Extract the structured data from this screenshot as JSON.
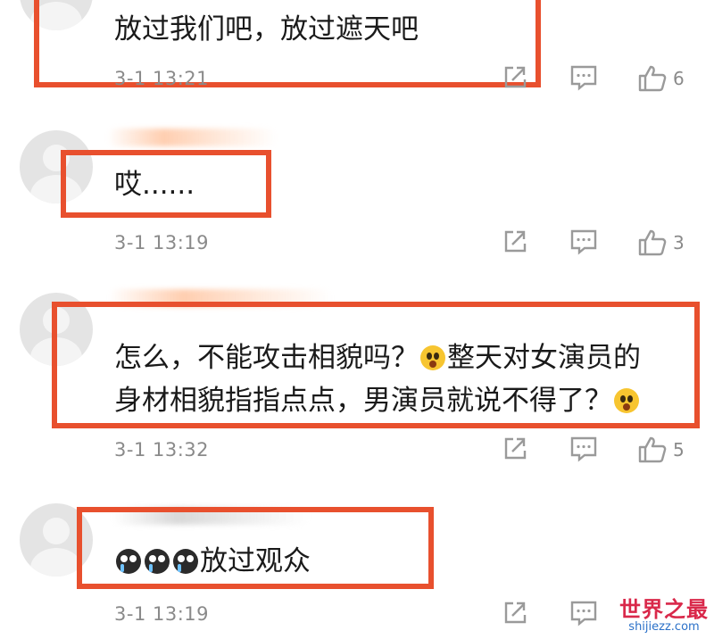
{
  "comments": [
    {
      "text_parts": [
        "放过我们吧，放过遮天吧"
      ],
      "time": "3-1 13:21",
      "likes": "6"
    },
    {
      "text_parts": [
        "哎......"
      ],
      "time": "3-1 13:19",
      "likes": "3"
    },
    {
      "line1": [
        "怎么，不能攻击相貌吗？",
        "整天对女演员的"
      ],
      "line2": [
        "身材相貌指指点点，男演员就说不得了？"
      ],
      "emoji_names": [
        "shocked-face-emoji",
        "shocked-face-emoji"
      ],
      "time": "3-1 13:32",
      "likes": "5"
    },
    {
      "text_parts": [
        "放过观众"
      ],
      "emoji_names": [
        "crying-face-emoji",
        "crying-face-emoji",
        "crying-face-emoji"
      ],
      "time": "3-1 13:19",
      "likes": ""
    }
  ],
  "watermark": {
    "title": "世界之最",
    "url": "shijiezz.com"
  },
  "colors": {
    "highlight": "#e8502e",
    "meta_text": "#8a8a8a",
    "icon": "#9a9a9a",
    "watermark_title": "#d9284a",
    "watermark_url": "#2a70c8"
  },
  "icons": [
    "share-icon",
    "reply-icon",
    "like-icon"
  ]
}
